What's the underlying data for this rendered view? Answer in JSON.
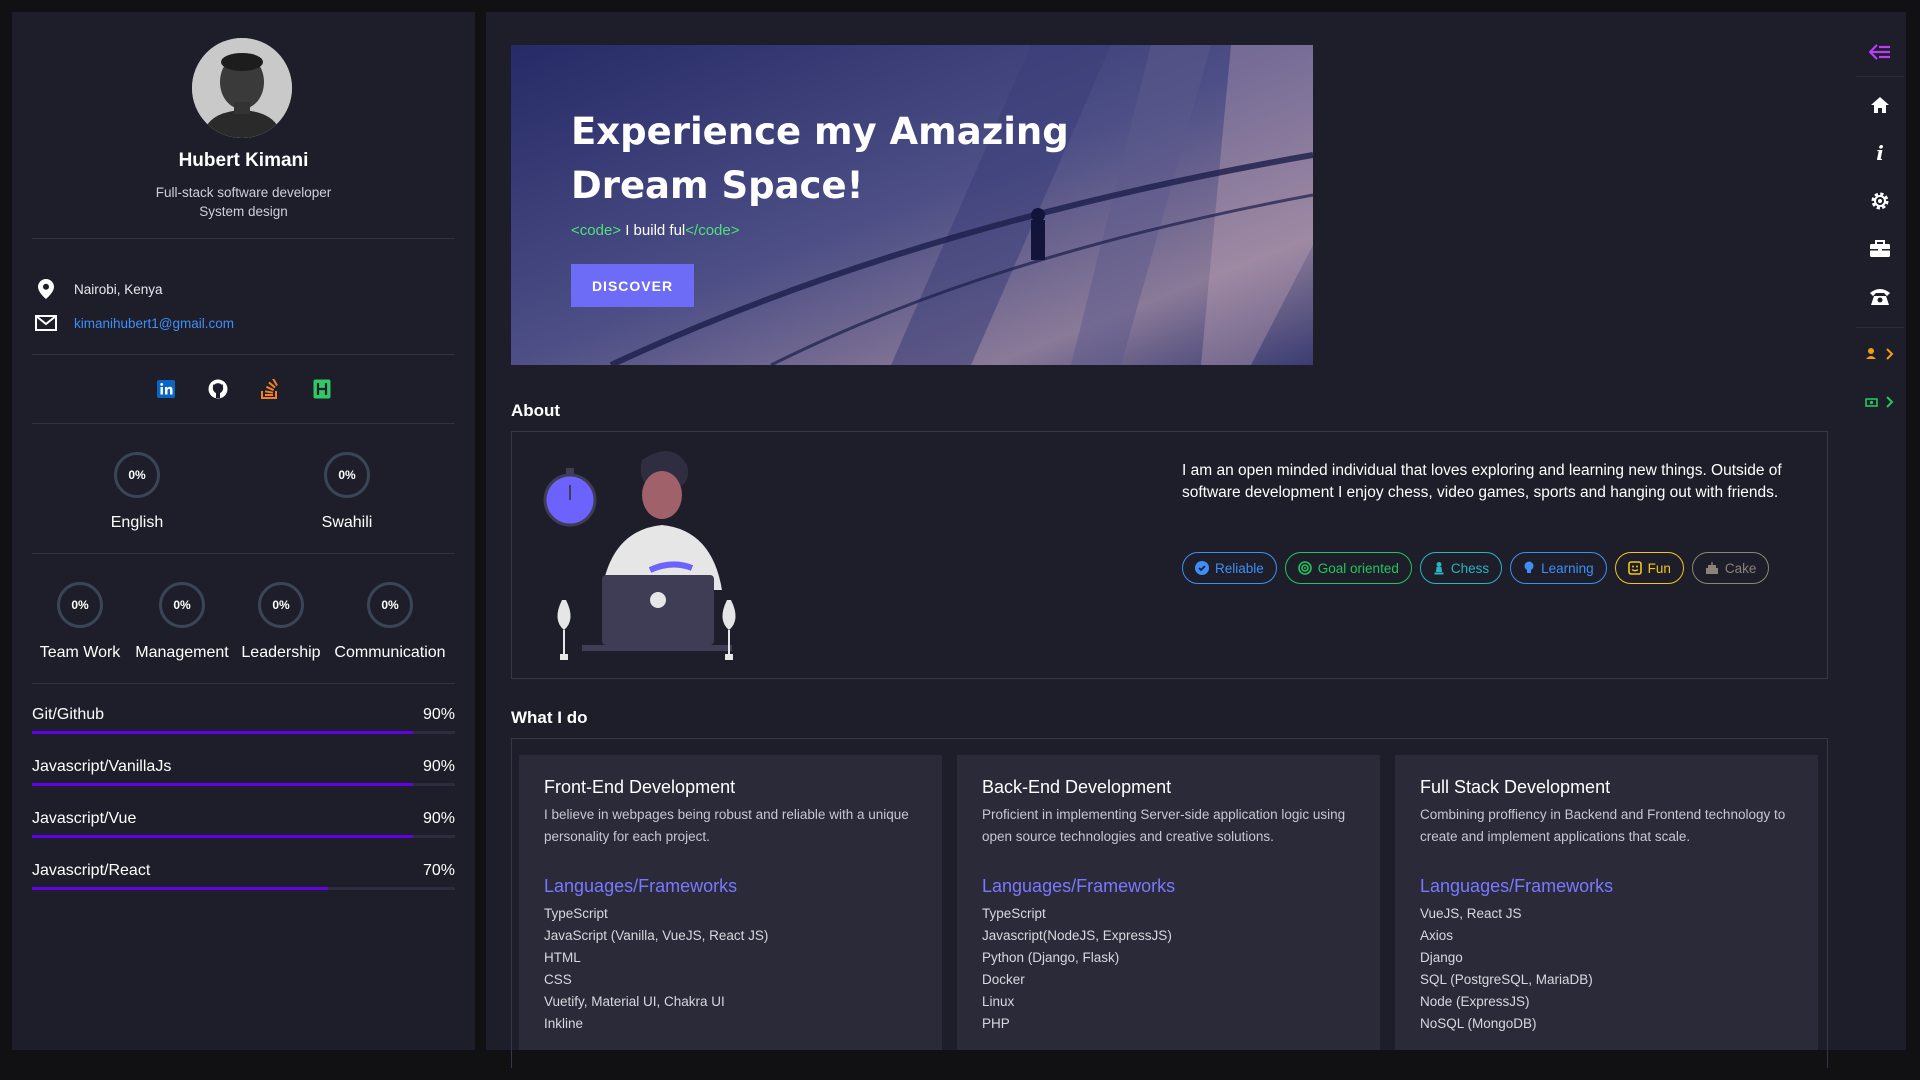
{
  "profile": {
    "name": "Hubert Kimani",
    "role_line1": "Full-stack software developer",
    "role_line2": "System design",
    "location": "Nairobi, Kenya",
    "email": "kimanihubert1@gmail.com"
  },
  "socials": [
    {
      "icon": "linkedin-icon",
      "color": "#0a66c2"
    },
    {
      "icon": "github-icon",
      "color": "#ffffff"
    },
    {
      "icon": "stackoverflow-icon",
      "color": "#f48024"
    },
    {
      "icon": "hackerrank-icon",
      "color": "#2ec866"
    }
  ],
  "languages": [
    {
      "label": "English",
      "value": "0%"
    },
    {
      "label": "Swahili",
      "value": "0%"
    }
  ],
  "soft_skills": [
    {
      "label": "Team Work",
      "value": "0%"
    },
    {
      "label": "Management",
      "value": "0%"
    },
    {
      "label": "Leadership",
      "value": "0%"
    },
    {
      "label": "Communication",
      "value": "0%"
    }
  ],
  "skills": [
    {
      "label": "Git/Github",
      "value": "90%",
      "fraction": 0.9
    },
    {
      "label": "Javascript/VanillaJs",
      "value": "90%",
      "fraction": 0.9
    },
    {
      "label": "Javascript/Vue",
      "value": "90%",
      "fraction": 0.9
    },
    {
      "label": "Javascript/React",
      "value": "70%",
      "fraction": 0.7
    }
  ],
  "hero": {
    "title_line1": "Experience my Amazing",
    "title_line2": "Dream Space!",
    "code_open": "<code>",
    "code_text": " I build ful",
    "code_close": "</code>",
    "discover": "DISCOVER"
  },
  "about": {
    "title": "About",
    "text": "I am an open minded individual that loves exploring and learning new things. Outside of software development I enjoy chess, video games, sports and hanging out with friends.",
    "chips": [
      {
        "label": "Reliable",
        "color": "#3e8ef7",
        "icon": "check-badge-icon"
      },
      {
        "label": "Goal oriented",
        "color": "#22c55e",
        "icon": "target-icon"
      },
      {
        "label": "Chess",
        "color": "#2bb3c0",
        "icon": "chess-pawn-icon"
      },
      {
        "label": "Learning",
        "color": "#3e8ef7",
        "icon": "lightbulb-icon"
      },
      {
        "label": "Fun",
        "color": "#f5c518",
        "icon": "smile-icon"
      },
      {
        "label": "Cake",
        "color": "#8a8378",
        "icon": "cake-icon"
      }
    ]
  },
  "whatido": {
    "title": "What I do",
    "cards": [
      {
        "title": "Front-End Development",
        "desc": "I believe in webpages being robust and reliable with a unique personality for each project.",
        "sub": "Languages/Frameworks",
        "items": [
          "TypeScript",
          "JavaScript (Vanilla, VueJS, React JS)",
          "HTML",
          "CSS",
          "Vuetify, Material UI, Chakra UI",
          "Inkline"
        ]
      },
      {
        "title": "Back-End Development",
        "desc": "Proficient in implementing Server-side application logic using open source technologies and creative solutions.",
        "sub": "Languages/Frameworks",
        "items": [
          "TypeScript",
          "Javascript(NodeJS, ExpressJS)",
          "Python (Django, Flask)",
          "Docker",
          "Linux",
          "PHP"
        ]
      },
      {
        "title": "Full Stack Development",
        "desc": "Combining proffiency in Backend and Frontend technology to create and implement applications that scale.",
        "sub": "Languages/Frameworks",
        "items": [
          "VueJS, React JS",
          "Axios",
          "Django",
          "SQL (PostgreSQL, MariaDB)",
          "Node (ExpressJS)",
          "NoSQL (MongoDB)"
        ]
      }
    ]
  },
  "rail": [
    {
      "icon": "collapse-arrow-icon",
      "color": "#b93cf6"
    },
    {
      "icon": "home-icon",
      "color": "#ffffff"
    },
    {
      "icon": "info-icon",
      "color": "#ffffff"
    },
    {
      "icon": "gear-icon",
      "color": "#ffffff"
    },
    {
      "icon": "briefcase-icon",
      "color": "#ffffff"
    },
    {
      "icon": "phone-icon",
      "color": "#ffffff"
    },
    {
      "icon": "user-chevron-icon",
      "color": "#f59e0b"
    },
    {
      "icon": "money-chevron-icon",
      "color": "#22c55e"
    }
  ],
  "colors": {
    "accent": "#6d6cf6",
    "bar": "#6200ea",
    "panel": "#1e1e2a",
    "background": "#111114"
  }
}
